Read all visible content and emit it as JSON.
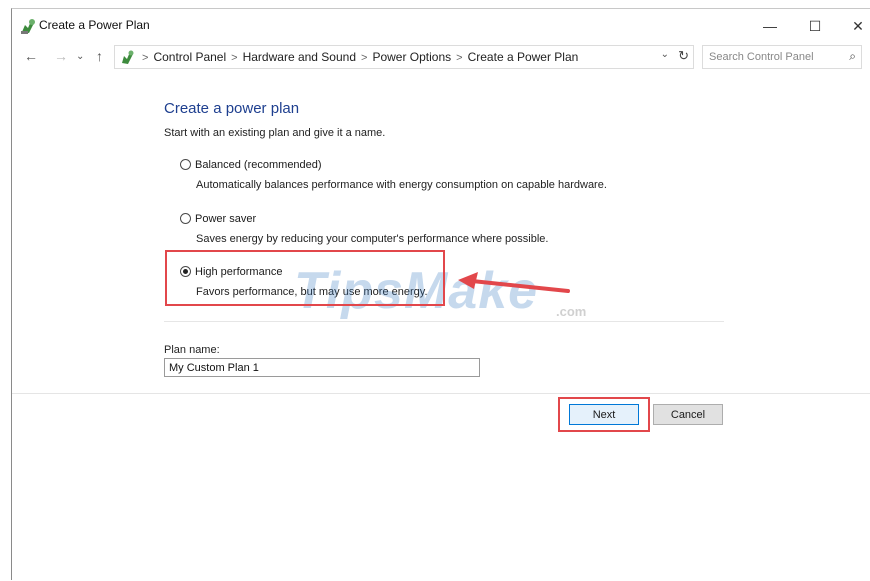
{
  "window": {
    "title": "Create a Power Plan",
    "controls": {
      "minimize": "—",
      "maximize": "☐",
      "close": "✕"
    }
  },
  "address": {
    "breadcrumbs": [
      "Control Panel",
      "Hardware and Sound",
      "Power Options",
      "Create a Power Plan"
    ],
    "separator": ">",
    "search_placeholder": "Search Control Panel"
  },
  "main": {
    "heading": "Create a power plan",
    "subtext": "Start with an existing plan and give it a name.",
    "options": [
      {
        "label": "Balanced (recommended)",
        "description": "Automatically balances performance with energy consumption on capable hardware.",
        "checked": false
      },
      {
        "label": "Power saver",
        "description": "Saves energy by reducing your computer's performance where possible.",
        "checked": false
      },
      {
        "label": "High performance",
        "description": "Favors performance, but may use more energy.",
        "checked": true
      }
    ],
    "plan_name_label": "Plan name:",
    "plan_name_value": "My Custom Plan 1"
  },
  "buttons": {
    "next": "Next",
    "cancel": "Cancel"
  },
  "watermark": {
    "text": "TipsMake",
    "suffix": ".com"
  },
  "colors": {
    "heading": "#1e3f8f",
    "highlight": "#e2474b",
    "primary_button_border": "#0078d7"
  }
}
